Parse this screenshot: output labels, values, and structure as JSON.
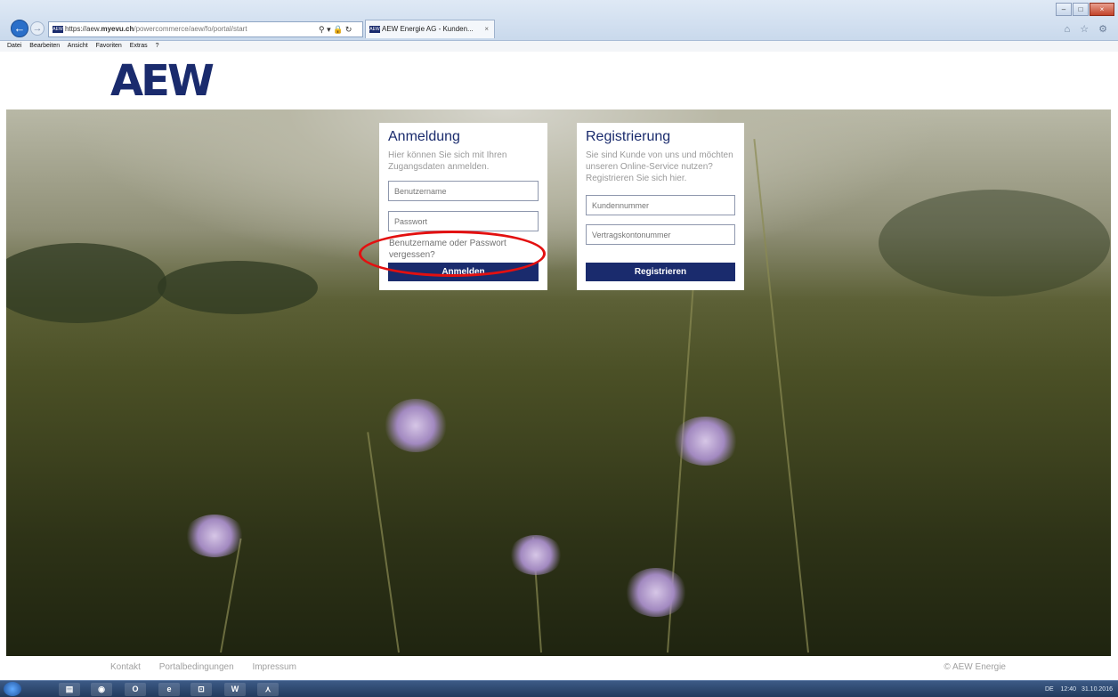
{
  "browser": {
    "url_prefix": "https://aew.",
    "url_domain": "myevu.ch",
    "url_path": "/powercommerce/aew/fo/portal/start",
    "tab_title": "AEW Energie AG - Kunden...",
    "tab_close": "×",
    "fav_label": "AEW",
    "addr_icons": "⚲ ▾ 🔒 ↻",
    "back_icon": "←",
    "forward_icon": "→",
    "tool_icons": "⌂ ☆ ⚙",
    "window_minimize": "–",
    "window_maximize": "□",
    "window_close": "×",
    "menu": [
      "Datei",
      "Bearbeiten",
      "Ansicht",
      "Favoriten",
      "Extras",
      "?"
    ]
  },
  "logo": {
    "text": "AEW"
  },
  "login": {
    "title": "Anmeldung",
    "description": "Hier können Sie sich mit Ihren Zugangsdaten anmelden.",
    "username_placeholder": "Benutzername",
    "password_placeholder": "Passwort",
    "forgot_text": "Benutzername oder Passwort vergessen?",
    "button": "Anmelden"
  },
  "register": {
    "title": "Registrierung",
    "description": "Sie sind Kunde von uns und möchten unseren Online-Service nutzen? Registrieren Sie sich hier.",
    "customer_number_placeholder": "Kundennummer",
    "contract_number_placeholder": "Vertragskontonummer",
    "button": "Registrieren"
  },
  "footer": {
    "links": [
      "Kontakt",
      "Portalbedingungen",
      "Impressum"
    ],
    "copyright": "© AEW Energie"
  },
  "taskbar": {
    "apps": [
      "▤",
      "◉",
      "O",
      "e",
      "⊡",
      "W",
      "⋏"
    ],
    "lang": "DE",
    "time": "12:40",
    "date": "31.10.2016"
  },
  "colors": {
    "brand": "#1a2b6d",
    "highlight": "#e31010"
  }
}
